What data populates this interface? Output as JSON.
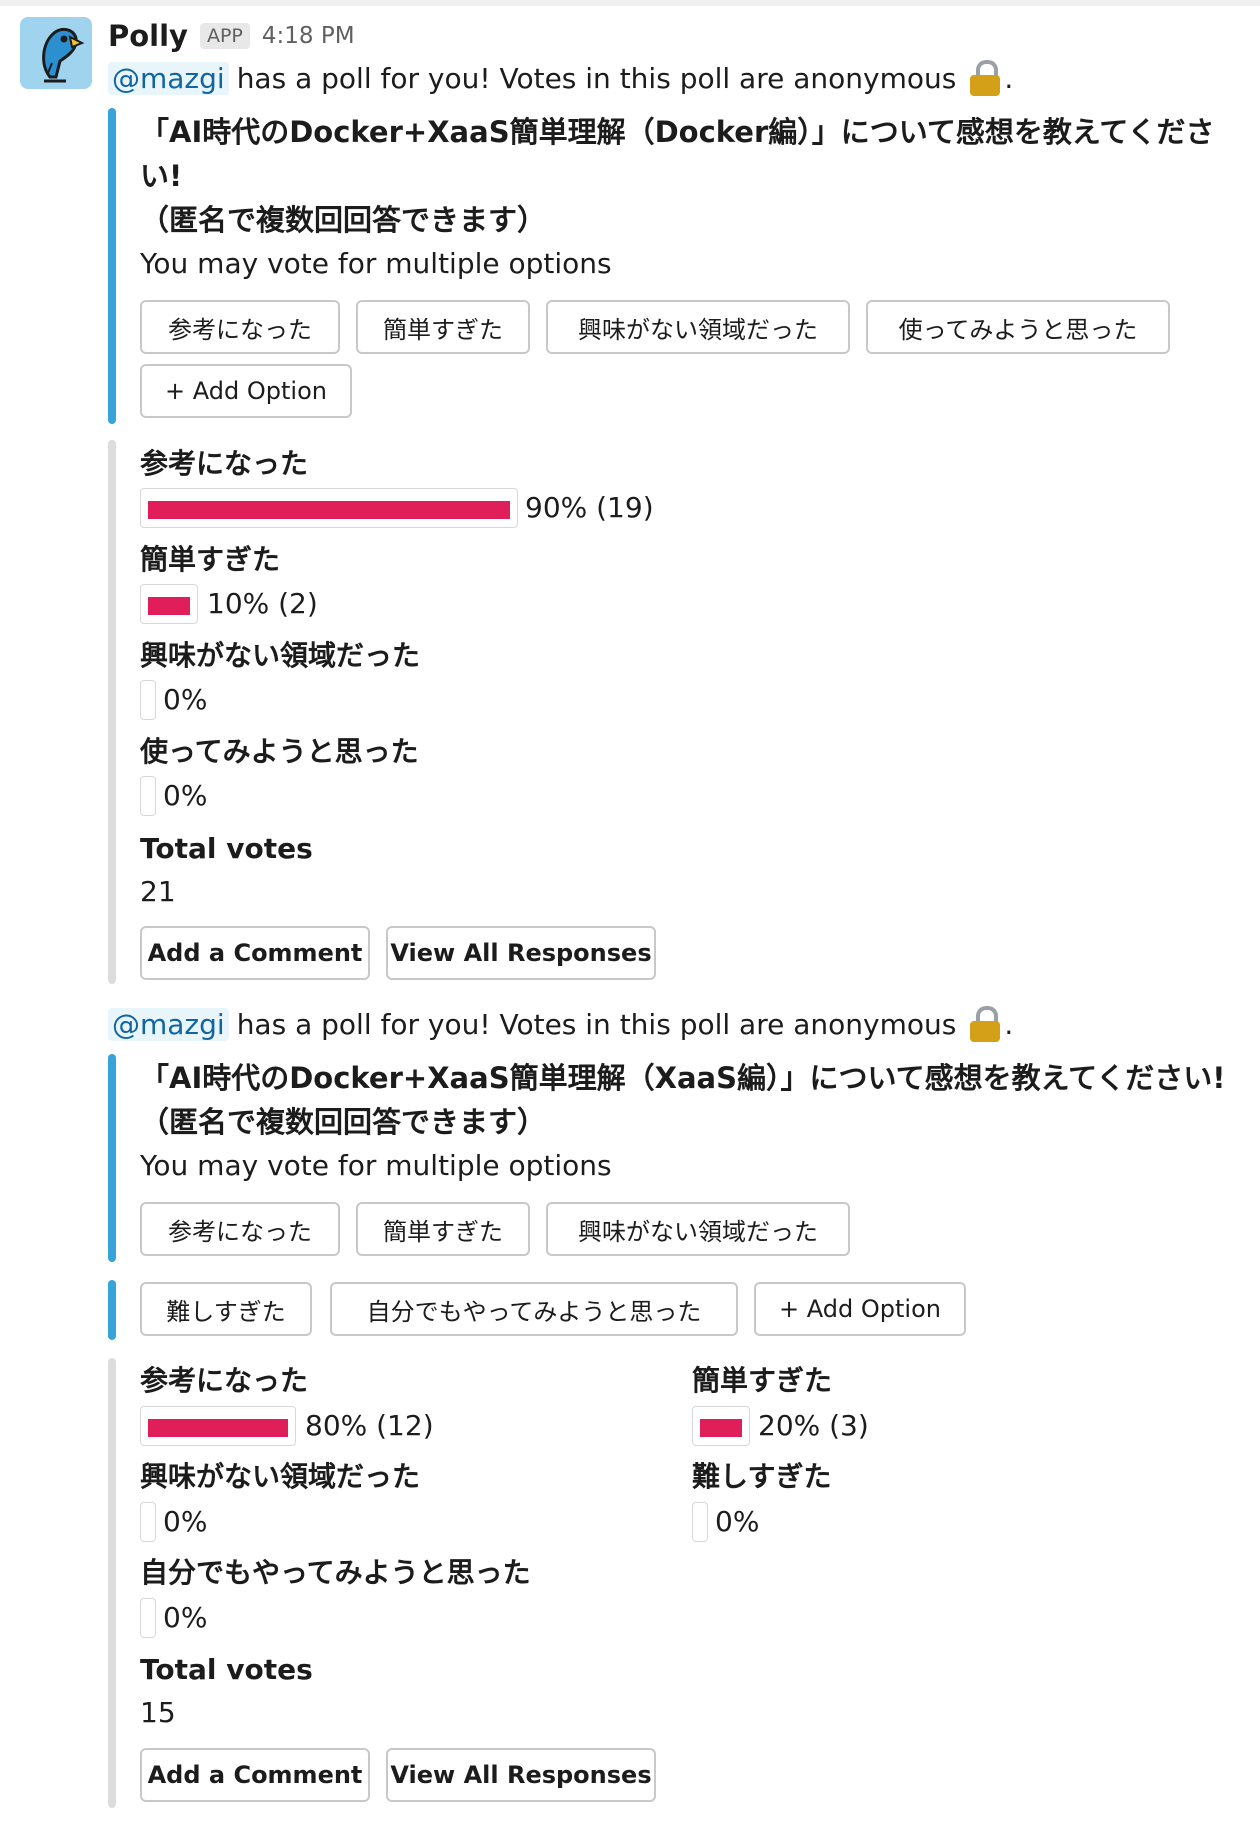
{
  "message": {
    "sender": "Polly",
    "badge": "APP",
    "time": "4:18 PM"
  },
  "colors": {
    "accent_blue": "#36a3d9",
    "bar_fill": "#e01e5a",
    "mention": "#1264a3"
  },
  "icons": {
    "avatar": "parrot-avatar-icon",
    "lock": "lock-icon"
  },
  "polls": [
    {
      "mention": "@mazgi",
      "intro": "has a poll for you! Votes in this poll are anonymous",
      "question_line1": "「AI時代のDocker+XaaS簡単理解（Docker編）」について感想を教えてくださ",
      "question_line2": "い!",
      "question_line3": "（匿名で複数回回答できます）",
      "subtitle": "You may vote for multiple options",
      "options": [
        "参考になった",
        "簡単すぎた",
        "興味がない領域だった",
        "使ってみようと思った"
      ],
      "add_option": "+ Add Option",
      "results": [
        {
          "label": "参考になった",
          "fraction": 0.9,
          "text": "90% (19)"
        },
        {
          "label": "簡単すぎた",
          "fraction": 0.1,
          "text": "10% (2)"
        },
        {
          "label": "興味がない領域だった",
          "fraction": 0,
          "text": "0%"
        },
        {
          "label": "使ってみようと思った",
          "fraction": 0,
          "text": "0%"
        }
      ],
      "total_label": "Total votes",
      "total": "21",
      "add_comment": "Add a Comment",
      "view_all": "View All Responses"
    },
    {
      "mention": "@mazgi",
      "intro": "has a poll for you! Votes in this poll are anonymous",
      "question_line1": "「AI時代のDocker+XaaS簡単理解（XaaS編）」について感想を教えてください!",
      "question_line2": "（匿名で複数回回答できます）",
      "subtitle": "You may vote for multiple options",
      "options": [
        "参考になった",
        "簡単すぎた",
        "興味がない領域だった",
        "難しすぎた",
        "自分でもやってみようと思った"
      ],
      "add_option": "+ Add Option",
      "results": [
        {
          "label": "参考になった",
          "fraction": 0.8,
          "text": "80% (12)"
        },
        {
          "label": "簡単すぎた",
          "fraction": 0.2,
          "text": "20% (3)"
        },
        {
          "label": "興味がない領域だった",
          "fraction": 0,
          "text": "0%"
        },
        {
          "label": "難しすぎた",
          "fraction": 0,
          "text": "0%"
        },
        {
          "label": "自分でもやってみようと思った",
          "fraction": 0,
          "text": "0%"
        }
      ],
      "total_label": "Total votes",
      "total": "15",
      "add_comment": "Add a Comment",
      "view_all": "View All Responses"
    }
  ]
}
